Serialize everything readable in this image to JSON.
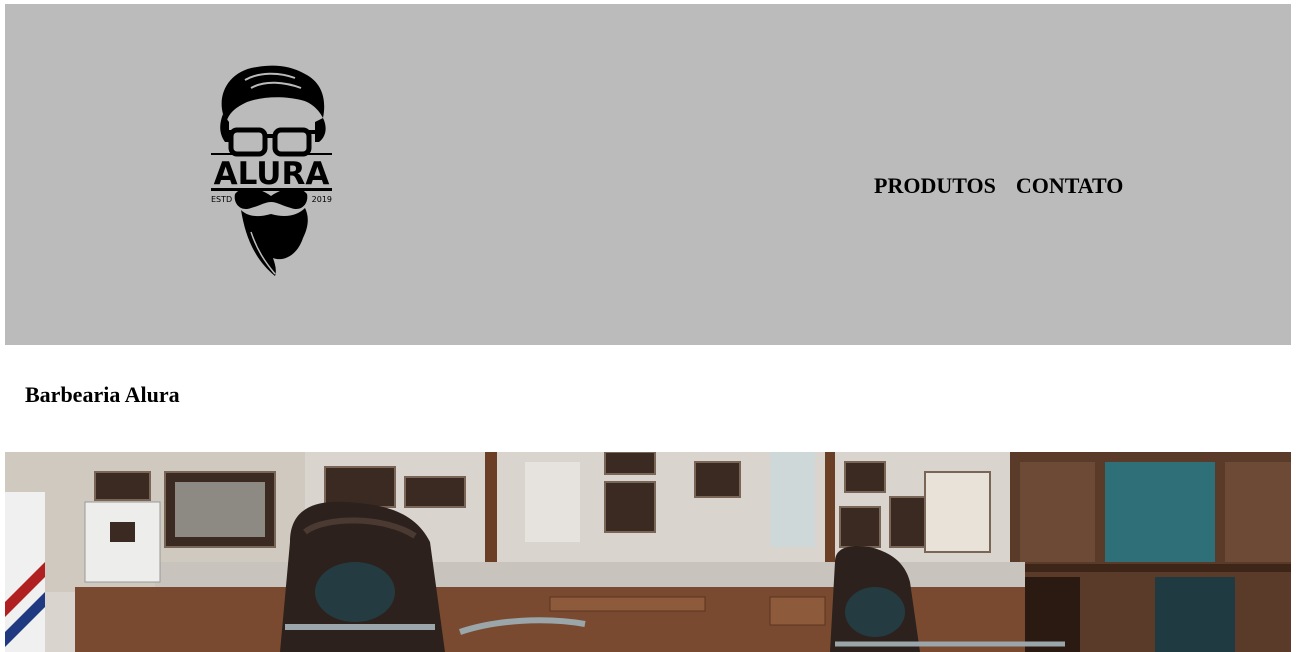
{
  "logo": {
    "brand": "ALURA",
    "estd_label": "ESTD",
    "year": "2019"
  },
  "nav": {
    "items": [
      {
        "label": "PRODUTOS"
      },
      {
        "label": "CONTATO"
      }
    ]
  },
  "main": {
    "title": "Barbearia Alura"
  },
  "colors": {
    "header_bg": "#bbbbbb",
    "text": "#000000"
  }
}
